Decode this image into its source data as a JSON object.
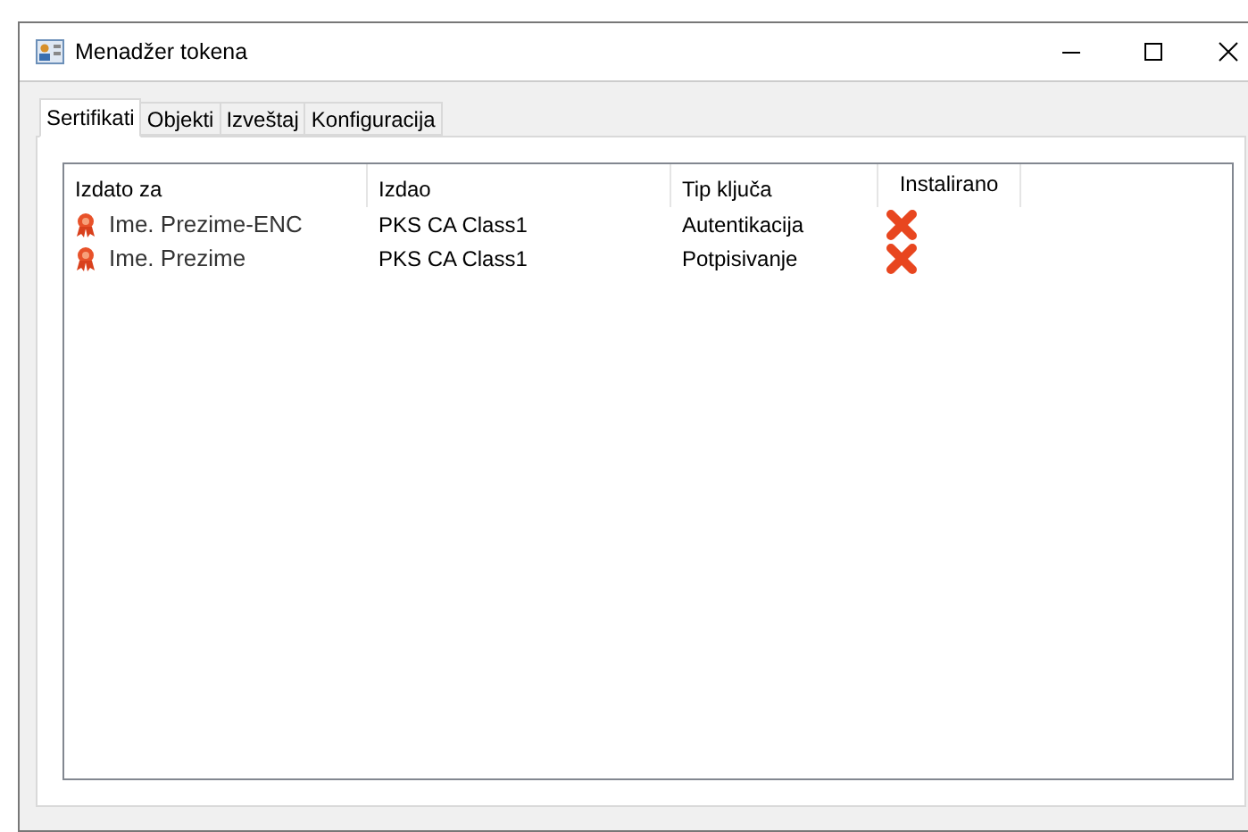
{
  "window": {
    "title": "Menadžer tokena"
  },
  "tabs": [
    {
      "label": "Sertifikati",
      "selected": true
    },
    {
      "label": "Objekti",
      "selected": false
    },
    {
      "label": "Izveštaj",
      "selected": false
    },
    {
      "label": "Konfiguracija",
      "selected": false
    }
  ],
  "table": {
    "columns": [
      "Izdato za",
      "Izdao",
      "Tip ključa",
      "Instalirano"
    ],
    "rows": [
      {
        "issued_to": "Ime. Prezime-ENC",
        "issuer": "PKS CA Class1",
        "key_type": "Autentikacija",
        "installed": false
      },
      {
        "issued_to": "Ime. Prezime",
        "issuer": "PKS CA Class1",
        "key_type": "Potpisivanje",
        "installed": false
      }
    ]
  }
}
